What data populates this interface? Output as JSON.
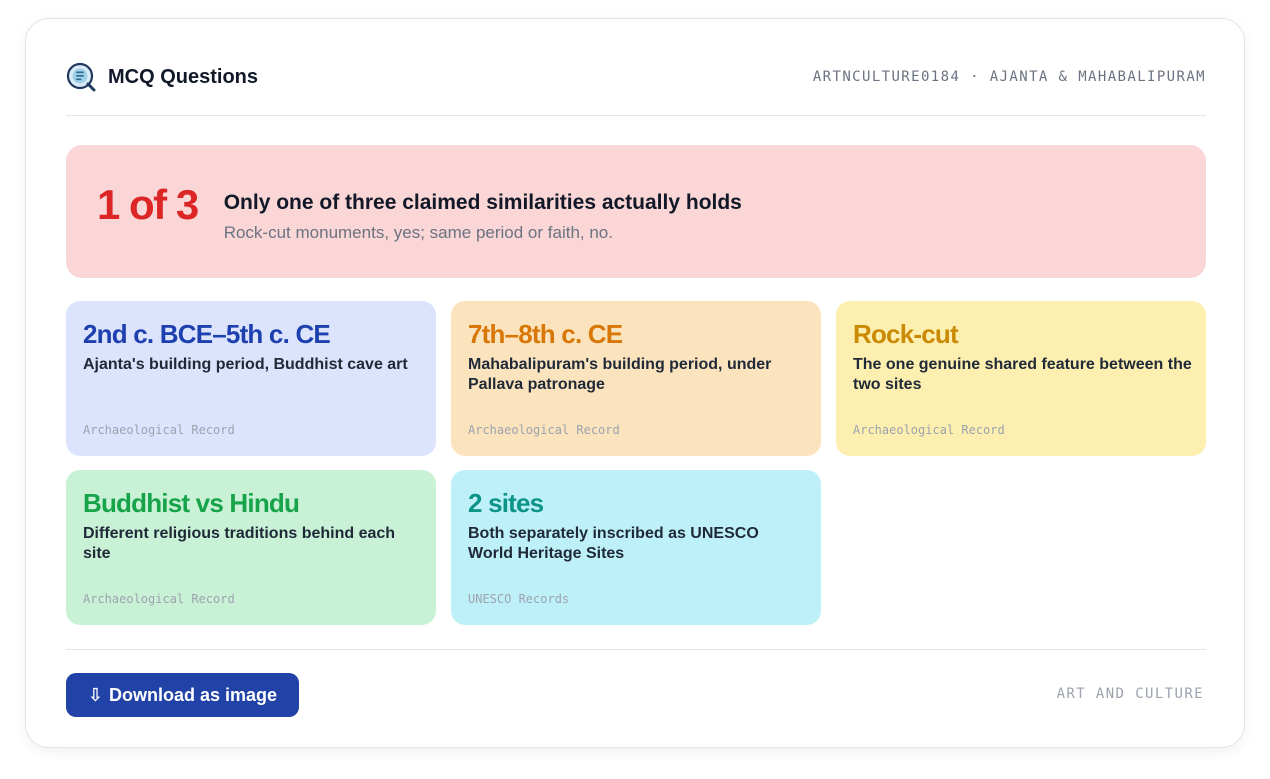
{
  "header": {
    "title": "MCQ Questions",
    "meta": "ARTNCULTURE0184 · AJANTA & MAHABALIPURAM",
    "logo_icon": "magnifier-question-icon"
  },
  "hero": {
    "big": "1 of 3",
    "headline": "Only one of three claimed similarities actually holds",
    "sub": "Rock-cut monuments, yes; same period or faith, no."
  },
  "tiles": [
    {
      "value": "2nd c. BCE–5th c. CE",
      "desc": "Ajanta's building period, Buddhist cave art",
      "source": "Archaeological Record",
      "bg": "#dbe4fc",
      "accent": "#1e40af"
    },
    {
      "value": "7th–8th c. CE",
      "desc": "Mahabalipuram's building period, under Pallava patronage",
      "source": "Archaeological Record",
      "bg": "#fbe3bd",
      "accent": "#d97706"
    },
    {
      "value": "Rock-cut",
      "desc": "The one genuine shared feature between the two sites",
      "source": "Archaeological Record",
      "bg": "#fcefaf",
      "accent": "#ca8a04"
    },
    {
      "value": "Buddhist vs Hindu",
      "desc": "Different religious traditions behind each site",
      "source": "Archaeological Record",
      "bg": "#c9f1d6",
      "accent": "#16a34a"
    },
    {
      "value": "2 sites",
      "desc": "Both separately inscribed as UNESCO World Heritage Sites",
      "source": "UNESCO Records",
      "bg": "#bdf0f8",
      "accent": "#0d9488"
    }
  ],
  "footer": {
    "download_label": "Download as image",
    "download_icon": "download-arrow-icon",
    "meta": "ART AND CULTURE"
  },
  "colors": {
    "hero_bg": "#fad6d6",
    "hero_accent": "#dc2626",
    "button": "#2142a6"
  }
}
